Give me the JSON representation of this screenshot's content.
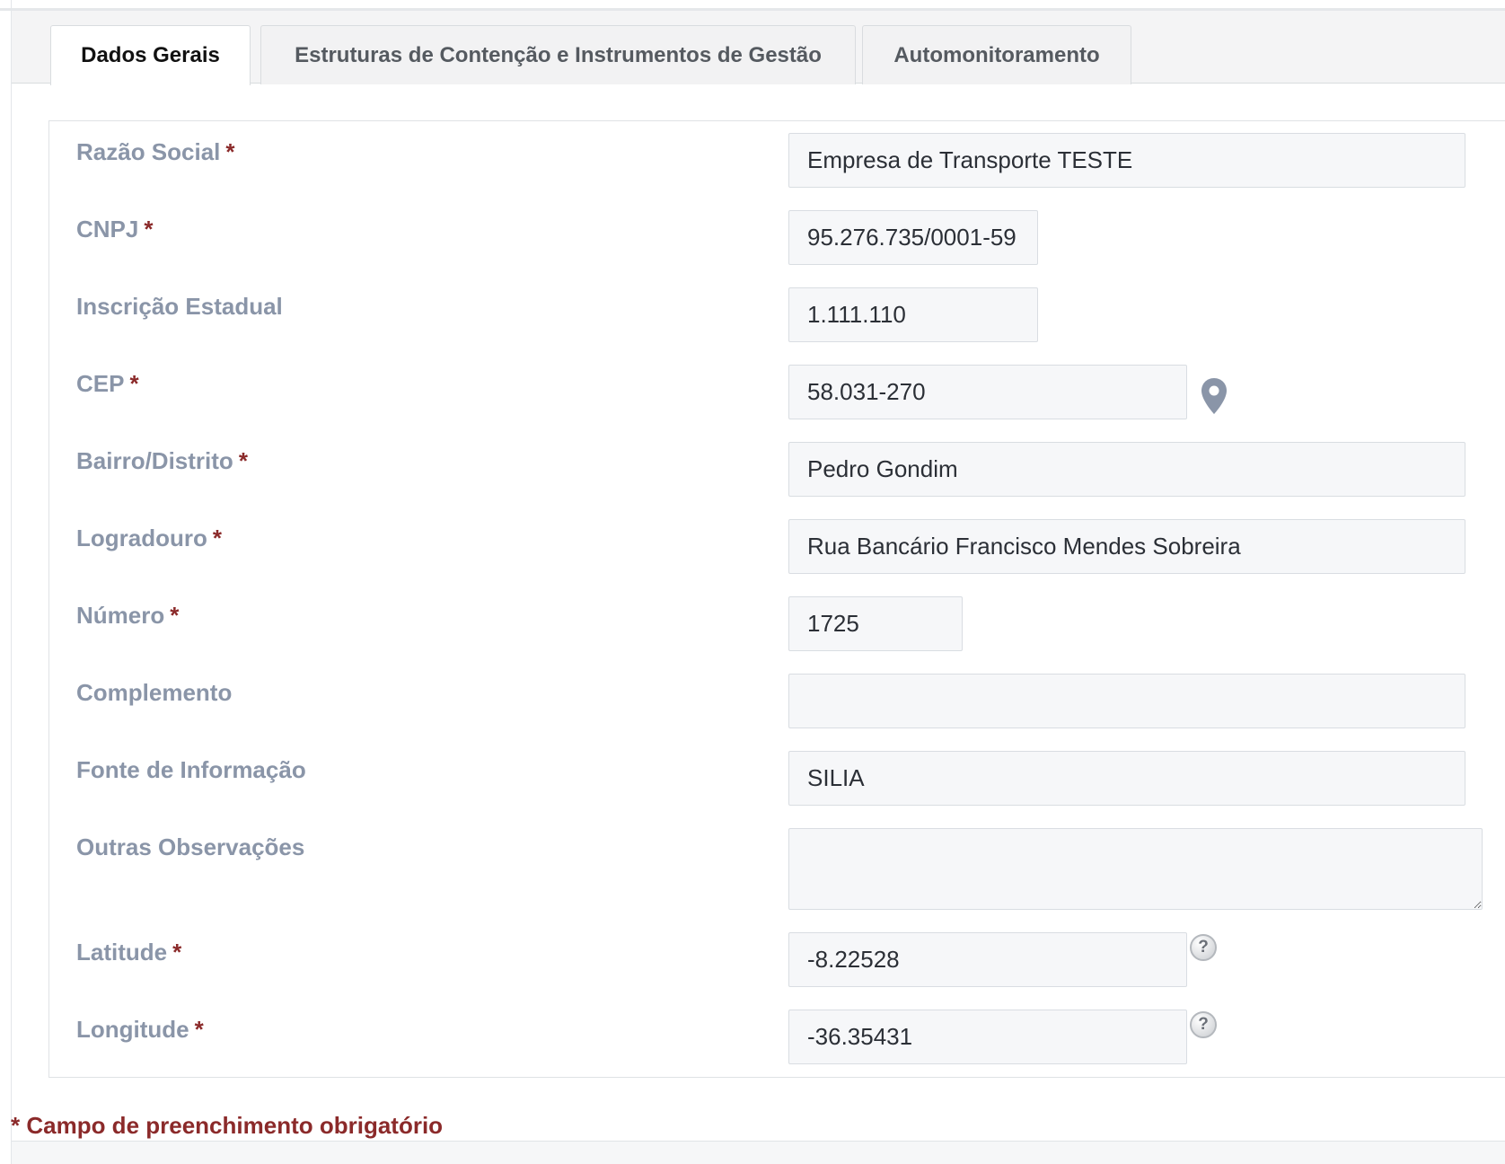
{
  "tabs": [
    {
      "label": "Dados Gerais",
      "active": true
    },
    {
      "label": "Estruturas de Contenção e Instrumentos de Gestão",
      "active": false
    },
    {
      "label": "Automonitoramento",
      "active": false
    }
  ],
  "fields": {
    "razao_social": {
      "label": "Razão Social",
      "value": "Empresa de Transporte TESTE"
    },
    "cnpj": {
      "label": "CNPJ",
      "value": "95.276.735/0001-59"
    },
    "inscricao_estadual": {
      "label": "Inscrição Estadual",
      "value": "1.111.110"
    },
    "cep": {
      "label": "CEP",
      "value": "58.031-270"
    },
    "bairro": {
      "label": "Bairro/Distrito",
      "value": "Pedro Gondim"
    },
    "logradouro": {
      "label": "Logradouro",
      "value": "Rua Bancário Francisco Mendes Sobreira"
    },
    "numero": {
      "label": "Número",
      "value": "1725"
    },
    "complemento": {
      "label": "Complemento",
      "value": ""
    },
    "fonte": {
      "label": "Fonte de Informação",
      "value": "SILIA"
    },
    "observacoes": {
      "label": "Outras Observações",
      "value": ""
    },
    "latitude": {
      "label": "Latitude",
      "value": "-8.22528"
    },
    "longitude": {
      "label": "Longitude",
      "value": "-36.35431"
    }
  },
  "required_marker": "*",
  "help_glyph": "?",
  "footnote": "* Campo de preenchimento obrigatório",
  "colors": {
    "required": "#8b2a2a",
    "label": "#8a95a8",
    "field_bg": "#f6f7f9"
  }
}
